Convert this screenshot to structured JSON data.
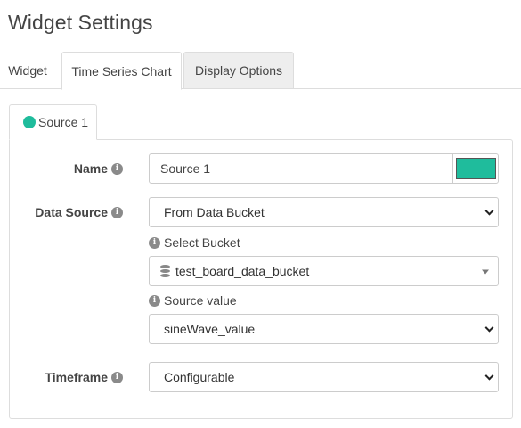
{
  "page": {
    "title": "Widget Settings"
  },
  "tabs": [
    {
      "label": "Widget",
      "active": false
    },
    {
      "label": "Time Series Chart",
      "active": true
    },
    {
      "label": "Display Options",
      "active": false
    }
  ],
  "source_tab": {
    "label": "Source 1",
    "color": "#1fbc9c"
  },
  "form": {
    "name": {
      "label": "Name",
      "value": "Source 1",
      "color": "#1fbc9c"
    },
    "data_source": {
      "label": "Data Source",
      "selected": "From Data Bucket"
    },
    "select_bucket": {
      "label": "Select Bucket",
      "selected": "test_board_data_bucket"
    },
    "source_value": {
      "label": "Source value",
      "selected": "sineWave_value"
    },
    "timeframe": {
      "label": "Timeframe",
      "selected": "Configurable"
    }
  },
  "icons": {
    "info": "info-circle-icon",
    "database": "database-icon",
    "dropdown": "chevron-down-icon"
  },
  "info_glyph": "i"
}
